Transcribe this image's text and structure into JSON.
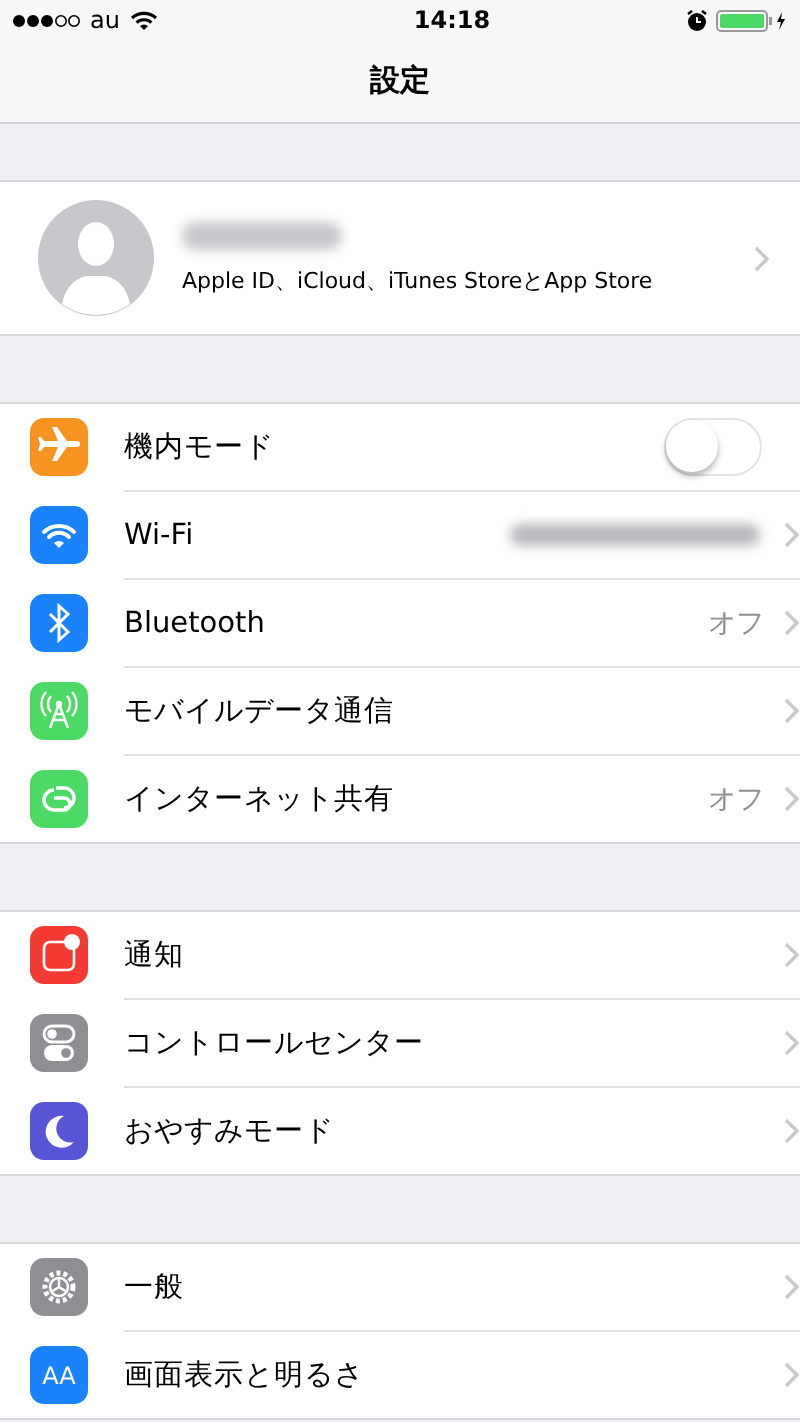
{
  "status_bar": {
    "carrier": "au",
    "time": "14:18"
  },
  "nav": {
    "title": "設定"
  },
  "profile": {
    "name_redacted": true,
    "subtitle": "Apple ID、iCloud、iTunes StoreとApp Store"
  },
  "groups": [
    {
      "items": [
        {
          "kind": "toggle",
          "label": "機内モード",
          "color": "#f7931e",
          "on": false
        },
        {
          "kind": "disclosure",
          "label": "Wi-Fi",
          "color": "#1a82fb",
          "value_redacted": true
        },
        {
          "kind": "disclosure",
          "label": "Bluetooth",
          "color": "#1a82fb",
          "value": "オフ"
        },
        {
          "kind": "disclosure",
          "label": "モバイルデータ通信",
          "color": "#4cd964"
        },
        {
          "kind": "disclosure",
          "label": "インターネット共有",
          "color": "#4cd964",
          "value": "オフ"
        }
      ]
    },
    {
      "items": [
        {
          "kind": "disclosure",
          "label": "通知",
          "color": "#f43a33"
        },
        {
          "kind": "disclosure",
          "label": "コントロールセンター",
          "color": "#8e8e93"
        },
        {
          "kind": "disclosure",
          "label": "おやすみモード",
          "color": "#5856d6"
        }
      ]
    },
    {
      "items": [
        {
          "kind": "disclosure",
          "label": "一般",
          "color": "#8e8e93"
        },
        {
          "kind": "disclosure",
          "label": "画面表示と明るさ",
          "color": "#1a82fb",
          "icon_text": "AA"
        }
      ]
    }
  ]
}
